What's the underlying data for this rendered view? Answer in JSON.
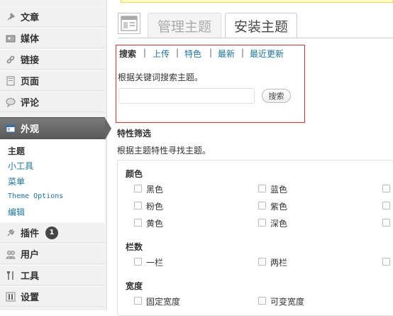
{
  "sidebar": {
    "items": [
      {
        "label": "文章",
        "icon": "pin-icon"
      },
      {
        "label": "媒体",
        "icon": "media-icon"
      },
      {
        "label": "链接",
        "icon": "link-icon"
      },
      {
        "label": "页面",
        "icon": "page-icon"
      },
      {
        "label": "评论",
        "icon": "comment-icon"
      },
      {
        "label": "外观",
        "icon": "appearance-icon"
      },
      {
        "label": "插件",
        "icon": "plugin-icon",
        "badge": "1"
      },
      {
        "label": "用户",
        "icon": "users-icon"
      },
      {
        "label": "工具",
        "icon": "tools-icon"
      },
      {
        "label": "设置",
        "icon": "settings-icon"
      }
    ],
    "submenu": [
      "主题",
      "小工具",
      "菜单",
      "Theme Options",
      "编辑"
    ]
  },
  "tabs": {
    "manage": "管理主题",
    "install": "安装主题"
  },
  "search_nav": [
    "搜索",
    "上传",
    "特色",
    "最新",
    "最近更新"
  ],
  "search": {
    "description": "根据关键词搜索主题。",
    "input_value": "",
    "button": "搜索"
  },
  "feature": {
    "title": "特性筛选",
    "description": "根据主题特性寻找主题。",
    "groups": {
      "color": {
        "title": "颜色",
        "options": [
          "黑色",
          "蓝色",
          "粉色",
          "紫色",
          "黄色",
          "深色"
        ]
      },
      "columns": {
        "title": "栏数",
        "options": [
          "一栏",
          "两栏"
        ]
      },
      "width": {
        "title": "宽度",
        "options": [
          "固定宽度",
          "可变宽度"
        ]
      }
    }
  },
  "colors": {
    "link": "#21759b",
    "highlight_border": "#cc3333",
    "current_menu": "#666666"
  }
}
